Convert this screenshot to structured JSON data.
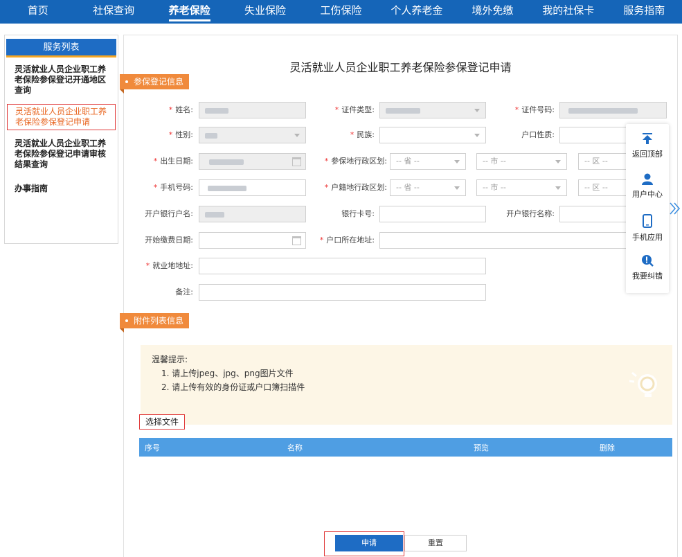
{
  "nav": {
    "items": [
      "首页",
      "社保查询",
      "养老保险",
      "失业保险",
      "工伤保险",
      "个人养老金",
      "境外免缴",
      "我的社保卡",
      "服务指南"
    ],
    "active_index": 2
  },
  "sidebar": {
    "title": "服务列表",
    "items": [
      {
        "label": "灵活就业人员企业职工养老保险参保登记开通地区查询",
        "active": false
      },
      {
        "label": "灵活就业人员企业职工养老保险参保登记申请",
        "active": true
      },
      {
        "label": "灵活就业人员企业职工养老保险参保登记申请审核结果查询",
        "active": false
      },
      {
        "label": "办事指南",
        "active": false
      }
    ]
  },
  "page": {
    "title": "灵活就业人员企业职工养老保险参保登记申请",
    "section1": "参保登记信息",
    "section2": "附件列表信息"
  },
  "form": {
    "name_label": "姓名:",
    "id_type_label": "证件类型:",
    "id_no_label": "证件号码:",
    "gender_label": "性别:",
    "ethnicity_label": "民族:",
    "hukou_type_label": "户口性质:",
    "birth_label": "出生日期:",
    "insure_region_label": "参保地行政区划:",
    "phone_label": "手机号码:",
    "hukou_region_label": "户籍地行政区划:",
    "bank_name_label": "开户银行户名:",
    "bank_card_label": "银行卡号:",
    "bank_label": "开户银行名称:",
    "start_date_label": "开始缴费日期:",
    "hukou_addr_label": "户口所在地址:",
    "work_addr_label": "就业地地址:",
    "remark_label": "备注:",
    "province_placeholder": "-- 省 --",
    "city_placeholder": "-- 市 --",
    "district_placeholder": "-- 区 --"
  },
  "tips": {
    "title": "温馨提示:",
    "line1": "1. 请上传jpeg、jpg、png图片文件",
    "line2": "2. 请上传有效的身份证或户口簿扫描件"
  },
  "upload": {
    "choose_label": "选择文件",
    "columns": [
      "序号",
      "名称",
      "预览",
      "删除"
    ]
  },
  "actions": {
    "submit": "申请",
    "reset": "重置"
  },
  "float": {
    "top": "返回顶部",
    "user": "用户中心",
    "mobile": "手机应用",
    "report": "我要纠错"
  },
  "colors": {
    "nav_bg": "#1565b8",
    "accent_orange": "#f08a3c",
    "required": "#e33333",
    "primary_button": "#1e6cc4",
    "table_head": "#4f9ee3"
  }
}
